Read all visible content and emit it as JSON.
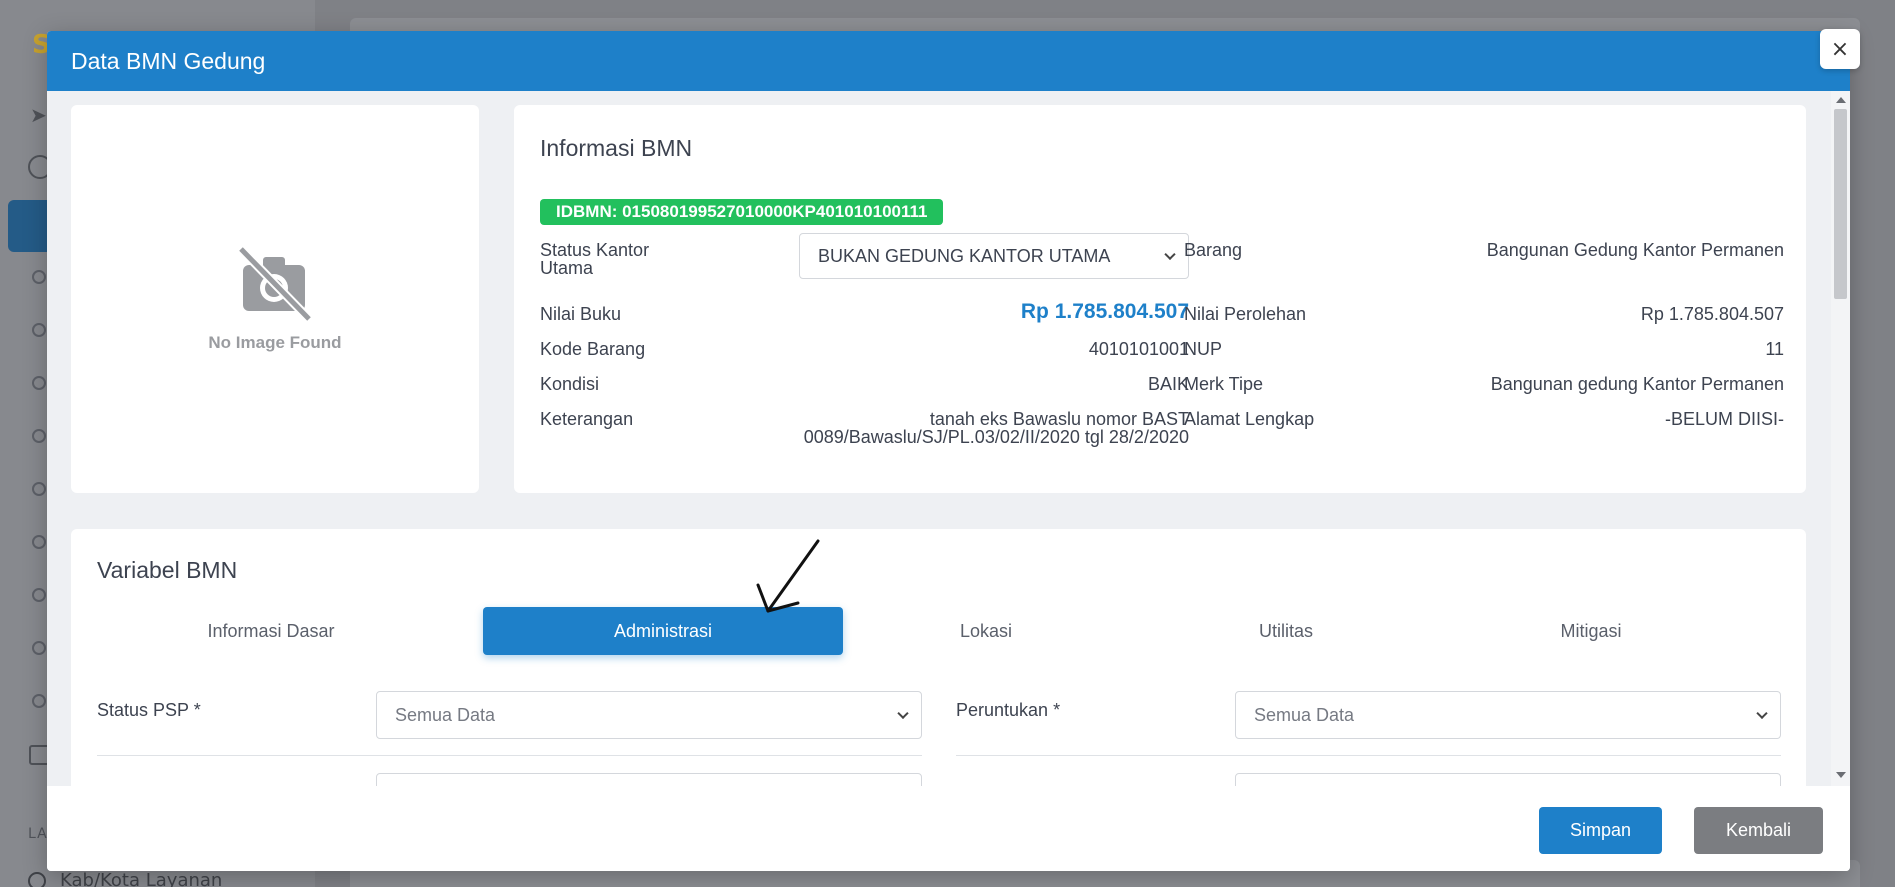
{
  "background": {
    "section_label": "LA",
    "bottom_link": "Kab/Kota Layanan"
  },
  "modal": {
    "title": "Data BMN Gedung",
    "close_label": "×"
  },
  "image_card": {
    "placeholder_text": "No Image Found"
  },
  "info": {
    "title": "Informasi BMN",
    "idbmn": "IDBMN: 015080199527010000KP401010100111",
    "status_kantor_label": "Status Kantor Utama",
    "status_kantor_value": "BUKAN GEDUNG KANTOR UTAMA",
    "left_fields": [
      {
        "label": "Nilai Buku",
        "value": "Rp 1.785.804.507"
      },
      {
        "label": "Kode Barang",
        "value": "4010101001"
      },
      {
        "label": "Kondisi",
        "value": "BAIK"
      },
      {
        "label": "Keterangan",
        "value": "tanah eks Bawaslu nomor BAST 0089/Bawaslu/SJ/PL.03/02/II/2020 tgl 28/2/2020"
      }
    ],
    "right_fields": [
      {
        "label": "Barang",
        "value": "Bangunan Gedung Kantor Permanen"
      },
      {
        "label": "Nilai Perolehan",
        "value": "Rp 1.785.804.507"
      },
      {
        "label": "NUP",
        "value": "11"
      },
      {
        "label": "Merk Tipe",
        "value": "Bangunan gedung Kantor Permanen"
      },
      {
        "label": "Alamat Lengkap",
        "value": "-BELUM DIISI-"
      }
    ]
  },
  "variabel": {
    "title": "Variabel BMN",
    "tabs": [
      {
        "label": "Informasi Dasar"
      },
      {
        "label": "Administrasi",
        "active": true
      },
      {
        "label": "Lokasi"
      },
      {
        "label": "Utilitas"
      },
      {
        "label": "Mitigasi"
      }
    ],
    "fields": [
      {
        "label": "Status PSP *",
        "value": "Semua Data"
      },
      {
        "label": "Peruntukan *",
        "value": "Semua Data"
      }
    ]
  },
  "footer": {
    "save_label": "Simpan",
    "back_label": "Kembali"
  },
  "colors": {
    "primary": "#1e80c9",
    "success": "#22c05d",
    "secondary": "#7b7d81"
  }
}
